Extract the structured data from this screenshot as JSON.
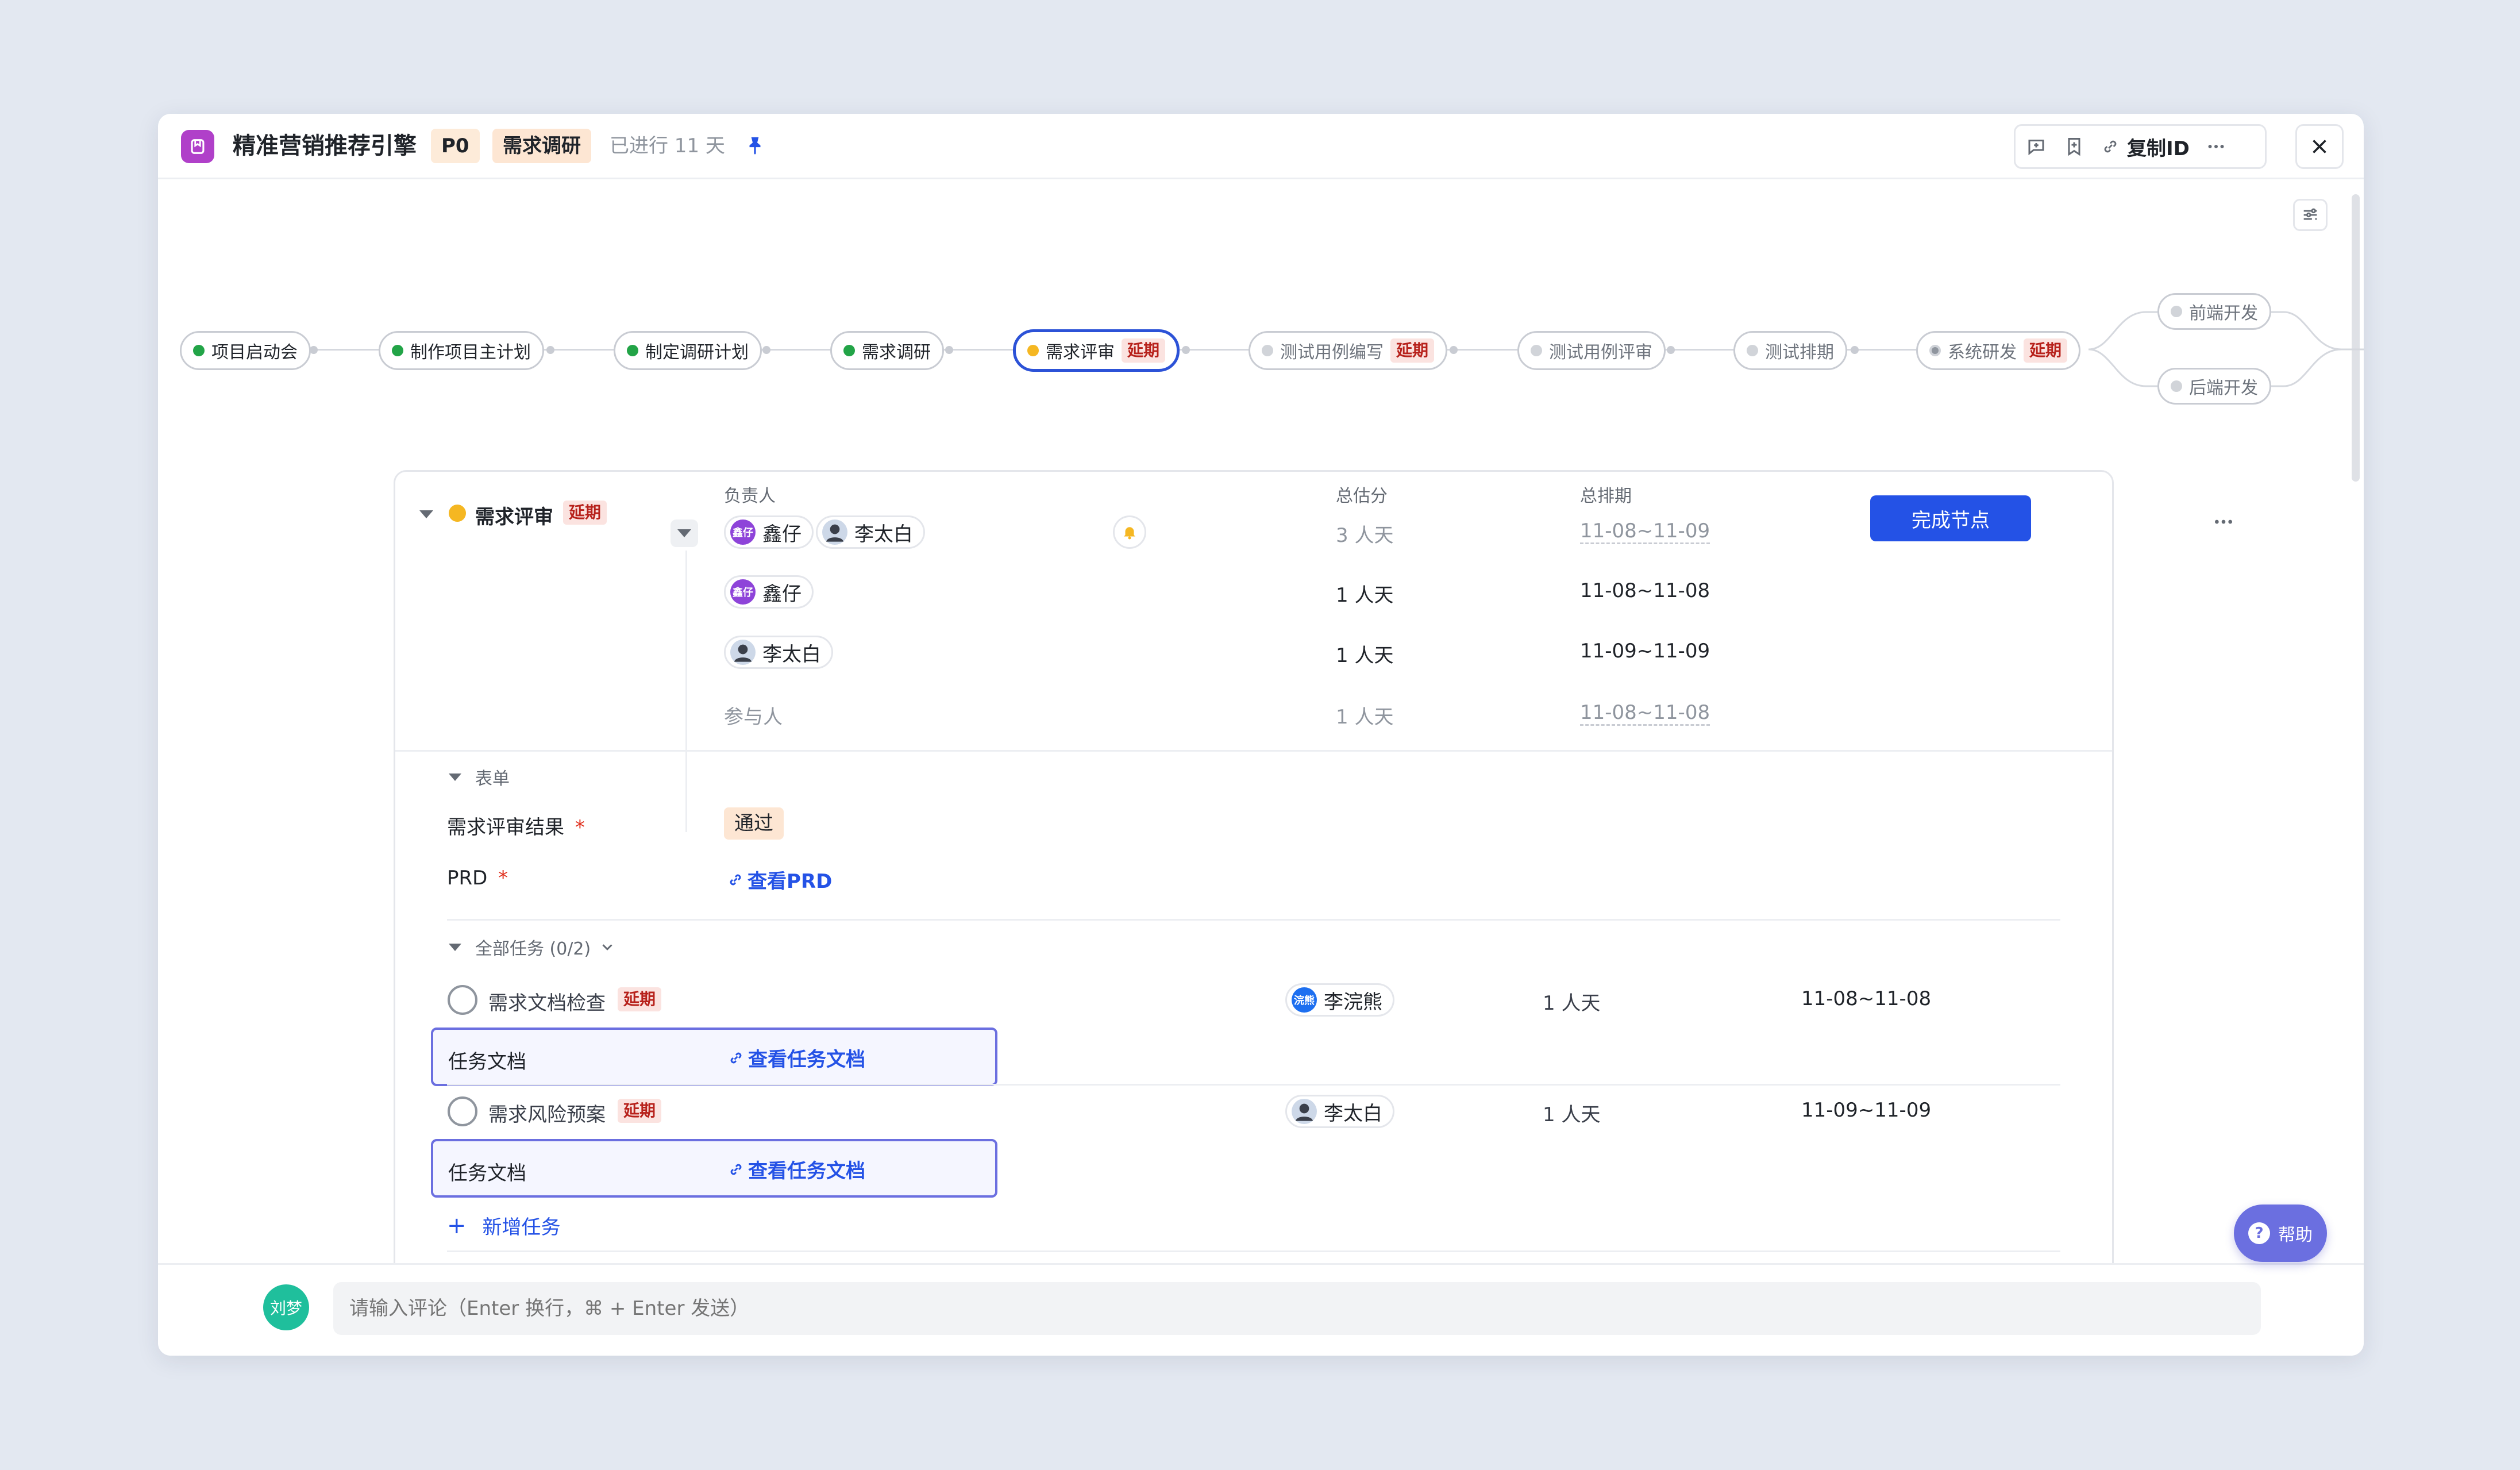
{
  "header": {
    "title": "精准营销推荐引擎",
    "priority": "P0",
    "stage": "需求调研",
    "elapsed": "已进行 11 天",
    "copy_id": "复制ID"
  },
  "flow": {
    "late_label": "延期",
    "nodes": [
      {
        "label": "项目启动会",
        "status": "done"
      },
      {
        "label": "制作项目主计划",
        "status": "done"
      },
      {
        "label": "制定调研计划",
        "status": "done"
      },
      {
        "label": "需求调研",
        "status": "done"
      },
      {
        "label": "需求评审",
        "status": "active"
      },
      {
        "label": "测试用例编写",
        "status": "pending"
      },
      {
        "label": "测试用例评审",
        "status": "pending"
      },
      {
        "label": "测试排期",
        "status": "pending"
      },
      {
        "label": "系统研发",
        "status": "in-progress"
      },
      {
        "label": "前端开发",
        "status": "pending"
      },
      {
        "label": "后端开发",
        "status": "pending"
      }
    ]
  },
  "node_detail": {
    "name": "需求评审",
    "late": "延期",
    "col_owner": "负责人",
    "col_estimate": "总估分",
    "col_schedule": "总排期",
    "complete_button": "完成节点",
    "summary": {
      "owners": [
        "鑫仔",
        "李太白"
      ],
      "estimate": "3 人天",
      "schedule": "11-08~11-09"
    },
    "rows": [
      {
        "owner": "鑫仔",
        "estimate": "1 人天",
        "schedule": "11-08~11-08"
      },
      {
        "owner": "李太白",
        "estimate": "1 人天",
        "schedule": "11-09~11-09"
      },
      {
        "owner": "参与人",
        "estimate": "1 人天",
        "schedule": "11-08~11-08"
      }
    ]
  },
  "form": {
    "section": "表单",
    "fields": [
      {
        "label": "需求评审结果",
        "value": "通过"
      },
      {
        "label": "PRD",
        "link": "查看PRD"
      }
    ],
    "required_mark": "*"
  },
  "tasks": {
    "section": "全部任务 (0/2)",
    "doc_label": "任务文档",
    "doc_link": "查看任务文档",
    "items": [
      {
        "name": "需求文档检查",
        "late": "延期",
        "owner": "李浣熊",
        "owner_initials": "浣熊",
        "estimate": "1 人天",
        "schedule": "11-08~11-08"
      },
      {
        "name": "需求风险预案",
        "late": "延期",
        "owner": "李太白",
        "estimate": "1 人天",
        "schedule": "11-09~11-09"
      }
    ],
    "add_task": "新增任务"
  },
  "footer": {
    "me": "刘梦",
    "comment_placeholder": "请输入评论（Enter 换行，⌘ + Enter 发送）"
  },
  "help": "帮助",
  "avatar_initials": {
    "xinzai": "鑫仔"
  },
  "colors": {
    "accent": "#2452e6",
    "done": "#22a447",
    "active": "#f5b722",
    "late": "#b7211b",
    "logo": "#b040c9"
  }
}
